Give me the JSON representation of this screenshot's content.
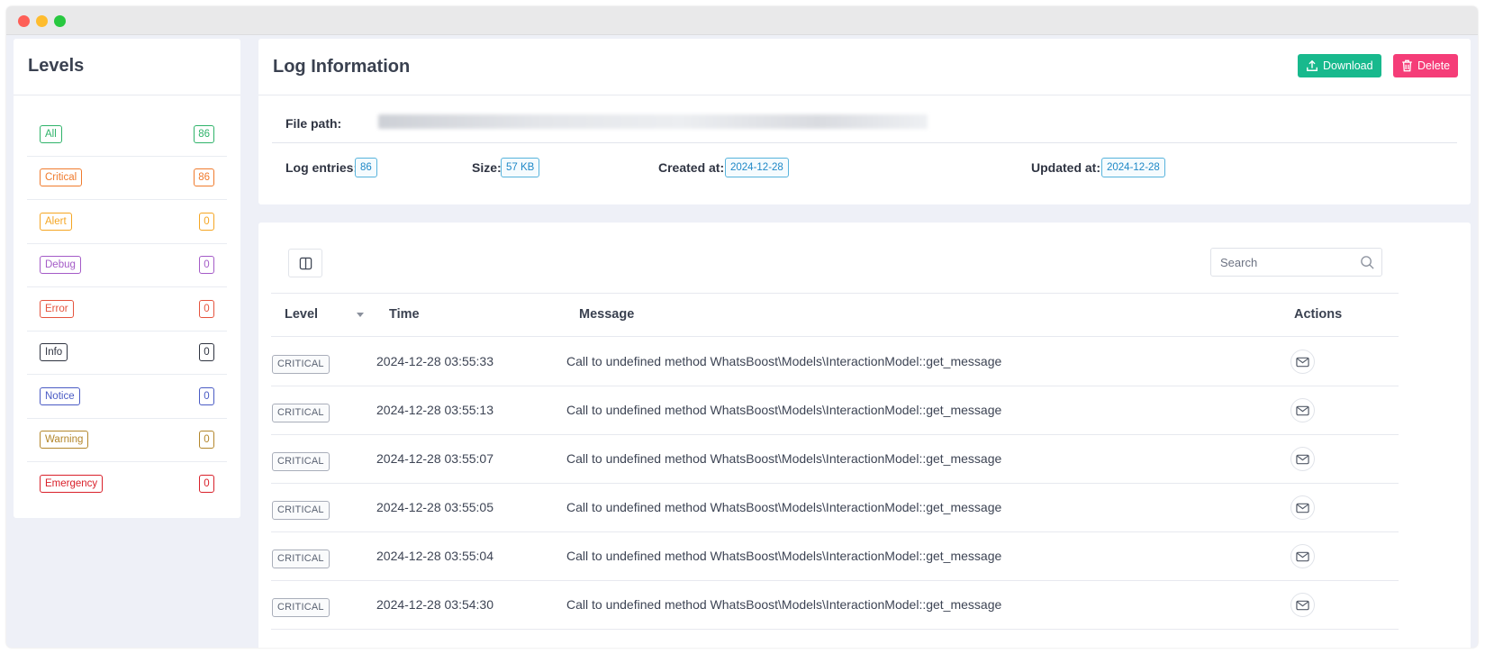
{
  "sidebar": {
    "title": "Levels",
    "items": [
      {
        "label": "All",
        "count": "86",
        "color": "#2fb36a"
      },
      {
        "label": "Critical",
        "count": "86",
        "color": "#f07b2d"
      },
      {
        "label": "Alert",
        "count": "0",
        "color": "#f5a623"
      },
      {
        "label": "Debug",
        "count": "0",
        "color": "#a45bc7"
      },
      {
        "label": "Error",
        "count": "0",
        "color": "#e5533d"
      },
      {
        "label": "Info",
        "count": "0",
        "color": "#2e3340"
      },
      {
        "label": "Notice",
        "count": "0",
        "color": "#4a5bc4"
      },
      {
        "label": "Warning",
        "count": "0",
        "color": "#b3862b"
      },
      {
        "label": "Emergency",
        "count": "0",
        "color": "#d9202a"
      }
    ]
  },
  "info": {
    "title": "Log Information",
    "download_label": "Download",
    "delete_label": "Delete",
    "file_path_label": "File path:",
    "log_entries_label": "Log entries:",
    "log_entries_value": "86",
    "size_label": "Size:",
    "size_value": "57 KB",
    "created_label": "Created at:",
    "created_value": "2024-12-28",
    "updated_label": "Updated at:",
    "updated_value": "2024-12-28"
  },
  "table": {
    "search_placeholder": "Search",
    "headers": {
      "level": "Level",
      "time": "Time",
      "message": "Message",
      "actions": "Actions"
    },
    "rows": [
      {
        "level": "CRITICAL",
        "time": "2024-12-28 03:55:33",
        "message": "Call to undefined method WhatsBoost\\Models\\InteractionModel::get_message"
      },
      {
        "level": "CRITICAL",
        "time": "2024-12-28 03:55:13",
        "message": "Call to undefined method WhatsBoost\\Models\\InteractionModel::get_message"
      },
      {
        "level": "CRITICAL",
        "time": "2024-12-28 03:55:07",
        "message": "Call to undefined method WhatsBoost\\Models\\InteractionModel::get_message"
      },
      {
        "level": "CRITICAL",
        "time": "2024-12-28 03:55:05",
        "message": "Call to undefined method WhatsBoost\\Models\\InteractionModel::get_message"
      },
      {
        "level": "CRITICAL",
        "time": "2024-12-28 03:55:04",
        "message": "Call to undefined method WhatsBoost\\Models\\InteractionModel::get_message"
      },
      {
        "level": "CRITICAL",
        "time": "2024-12-28 03:54:30",
        "message": "Call to undefined method WhatsBoost\\Models\\InteractionModel::get_message"
      }
    ]
  },
  "icons": {
    "download": "upload-icon",
    "delete": "trash-icon",
    "columns": "columns-icon",
    "search": "search-icon",
    "action": "mail-icon"
  }
}
